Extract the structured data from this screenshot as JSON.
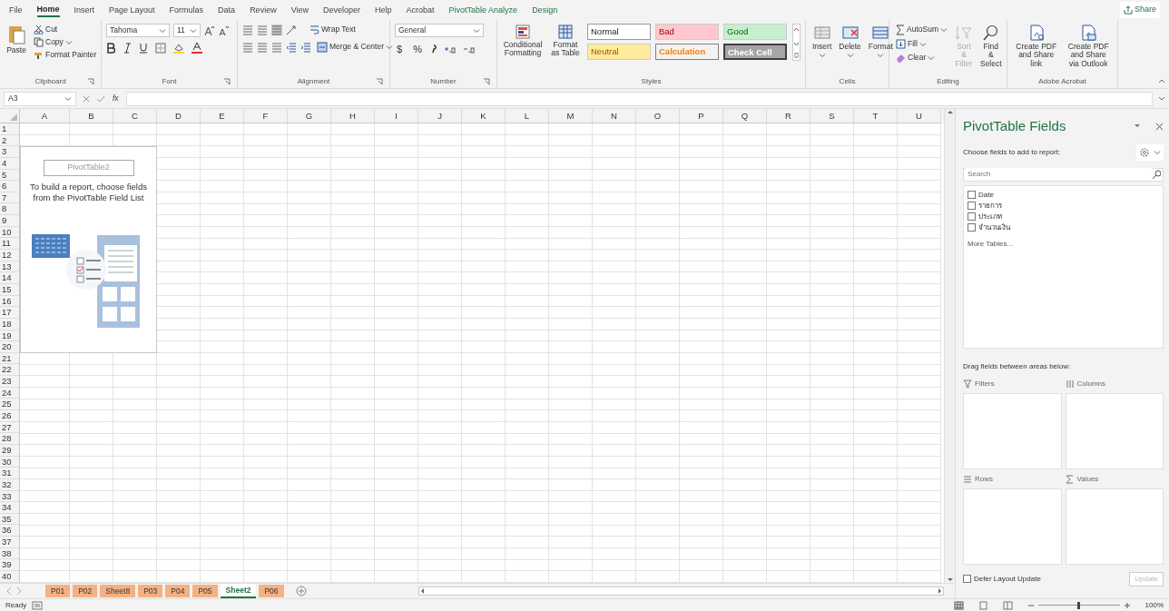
{
  "menu_tabs": [
    {
      "label": "File",
      "selected": false,
      "kind": "standard"
    },
    {
      "label": "Home",
      "selected": true,
      "kind": "standard"
    },
    {
      "label": "Insert",
      "selected": false,
      "kind": "standard"
    },
    {
      "label": "Page Layout",
      "selected": false,
      "kind": "standard"
    },
    {
      "label": "Formulas",
      "selected": false,
      "kind": "standard"
    },
    {
      "label": "Data",
      "selected": false,
      "kind": "standard"
    },
    {
      "label": "Review",
      "selected": false,
      "kind": "standard"
    },
    {
      "label": "View",
      "selected": false,
      "kind": "standard"
    },
    {
      "label": "Developer",
      "selected": false,
      "kind": "standard"
    },
    {
      "label": "Help",
      "selected": false,
      "kind": "standard"
    },
    {
      "label": "Acrobat",
      "selected": false,
      "kind": "standard"
    },
    {
      "label": "PivotTable Analyze",
      "selected": false,
      "kind": "contextual"
    },
    {
      "label": "Design",
      "selected": false,
      "kind": "contextual"
    }
  ],
  "share": "Share",
  "clipboard": {
    "paste": "Paste",
    "cut": "Cut",
    "copy": "Copy",
    "format_painter": "Format Painter",
    "label": "Clipboard"
  },
  "font": {
    "name": "Tahoma",
    "size": "11",
    "label": "Font"
  },
  "alignment": {
    "wrap": "Wrap Text",
    "merge": "Merge & Center",
    "label": "Alignment"
  },
  "number": {
    "format": "General",
    "currency": "$",
    "percent": "%",
    "label": "Number"
  },
  "styles": {
    "conditional": "Conditional Formatting",
    "format_table": "Format as Table",
    "label": "Styles",
    "cells": [
      {
        "label": "Normal",
        "kind": "normal"
      },
      {
        "label": "Bad",
        "kind": "bad"
      },
      {
        "label": "Good",
        "kind": "good"
      },
      {
        "label": "Neutral",
        "kind": "neutral"
      },
      {
        "label": "Calculation",
        "kind": "calculation"
      },
      {
        "label": "Check Cell",
        "kind": "check"
      }
    ]
  },
  "cells_group": {
    "buttons": [
      "Insert",
      "Delete",
      "Format"
    ],
    "label": "Cells"
  },
  "editing": {
    "autosum": "AutoSum",
    "fill": "Fill",
    "clear": "Clear",
    "sort": "Sort & Filter",
    "find": "Find & Select",
    "label": "Editing"
  },
  "acrobat": {
    "buttons": [
      "Create PDF and Share link",
      "Create PDF and Share via Outlook"
    ],
    "label": "Adobe Acrobat"
  },
  "formula_bar": {
    "name_box": "A3",
    "function_label": "fx"
  },
  "sheet": {
    "columns": [
      "A",
      "B",
      "C",
      "D",
      "E",
      "F",
      "G",
      "H",
      "I",
      "J",
      "K",
      "L",
      "M",
      "N",
      "O",
      "P",
      "Q",
      "R",
      "S",
      "T",
      "U"
    ],
    "rows": [
      "1",
      "2",
      "3",
      "4",
      "5",
      "6",
      "7",
      "8",
      "9",
      "10",
      "11",
      "12",
      "13",
      "14",
      "15",
      "16",
      "17",
      "18",
      "19",
      "20",
      "21",
      "22",
      "23",
      "24",
      "25",
      "26",
      "27",
      "28",
      "29",
      "30",
      "31",
      "32",
      "33",
      "34",
      "35",
      "36",
      "37",
      "38",
      "39",
      "40"
    ],
    "pivot_placeholder": {
      "title": "PivotTable2",
      "message": "To build a report, choose fields from the PivotTable Field List"
    }
  },
  "sheet_tabs": [
    {
      "label": "P01",
      "selected": false
    },
    {
      "label": "P02",
      "selected": false
    },
    {
      "label": "Sheet8",
      "selected": false
    },
    {
      "label": "P03",
      "selected": false
    },
    {
      "label": "P04",
      "selected": false
    },
    {
      "label": "P05",
      "selected": false
    },
    {
      "label": "Sheet2",
      "selected": true
    },
    {
      "label": "P06",
      "selected": false
    }
  ],
  "pivot_pane": {
    "title": "PivotTable Fields",
    "choose": "Choose fields to add to report:",
    "search_placeholder": "Search",
    "fields": [
      {
        "label": "Date",
        "checked": false
      },
      {
        "label": "รายการ",
        "checked": false
      },
      {
        "label": "ประเภท",
        "checked": false
      },
      {
        "label": "จำนวนเงิน",
        "checked": false
      }
    ],
    "more": "More Tables...",
    "drag": "Drag fields between areas below:",
    "areas": [
      {
        "label": "Filters",
        "kind": "filters"
      },
      {
        "label": "Columns",
        "kind": "columns"
      },
      {
        "label": "Rows",
        "kind": "rows"
      },
      {
        "label": "Values",
        "kind": "values"
      }
    ],
    "defer": {
      "label": "Defer Layout Update",
      "checked": false
    },
    "update": {
      "label": "Update",
      "disabled": true
    }
  },
  "status": {
    "text": "Ready",
    "zoom_slider": {
      "level": 0.5
    },
    "zoom": "100%"
  }
}
